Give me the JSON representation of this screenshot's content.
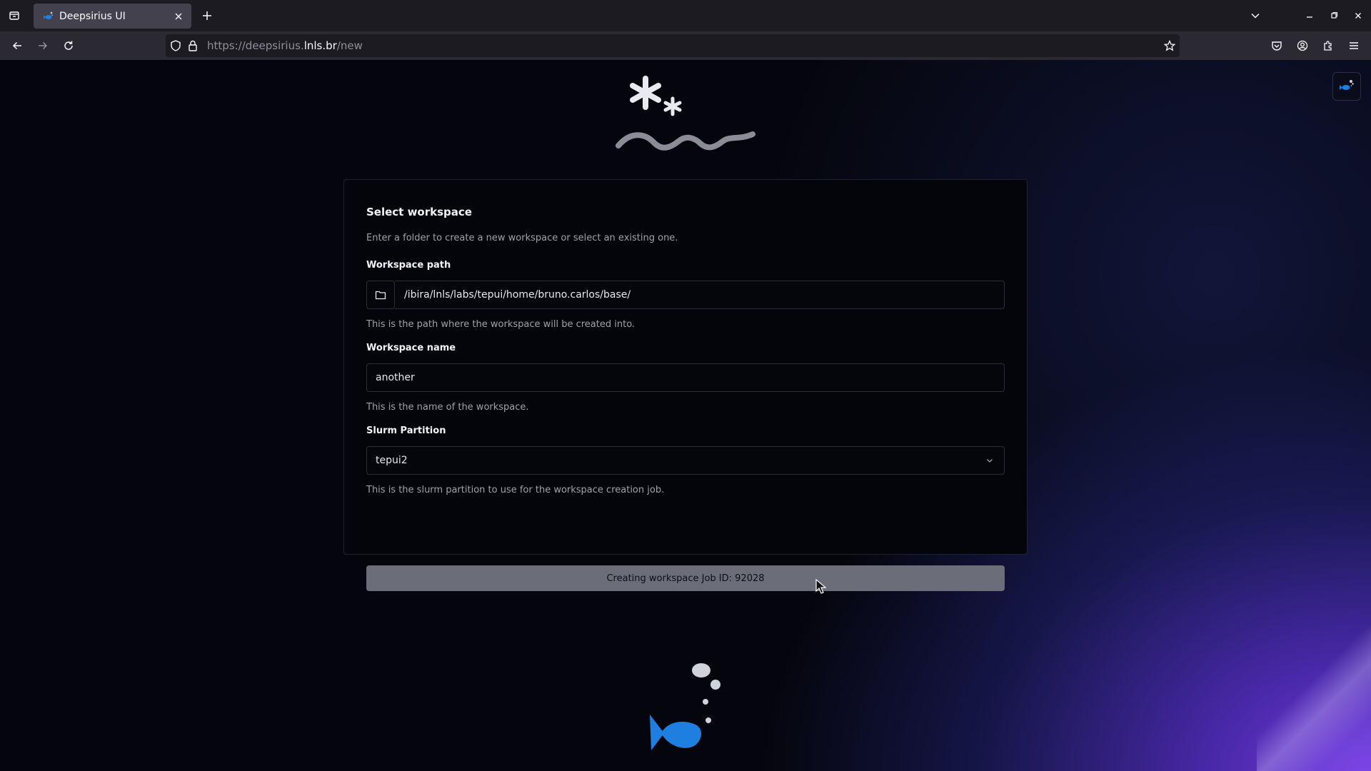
{
  "browser": {
    "tab_title": "Deepsirius UI",
    "url_prefix": "https://deepsirius.",
    "url_host": "lnls.br",
    "url_path": "/new"
  },
  "form": {
    "title": "Select workspace",
    "description": "Enter a folder to create a new workspace or select an existing one.",
    "path_label": "Workspace path",
    "path_value": "/ibira/lnls/labs/tepui/home/bruno.carlos/base/",
    "path_help": "This is the path where the workspace will be created into.",
    "name_label": "Workspace name",
    "name_value": "another",
    "name_help": "This is the name of the workspace.",
    "partition_label": "Slurm Partition",
    "partition_value": "tepui2",
    "partition_help": "This is the slurm partition to use for the workspace creation job.",
    "submit_label": "Creating workspace Job ID: 92028"
  },
  "colors": {
    "accent_blue": "#1e7fe0",
    "card_bg": "#04050b",
    "button_disabled": "#6b6e78"
  }
}
